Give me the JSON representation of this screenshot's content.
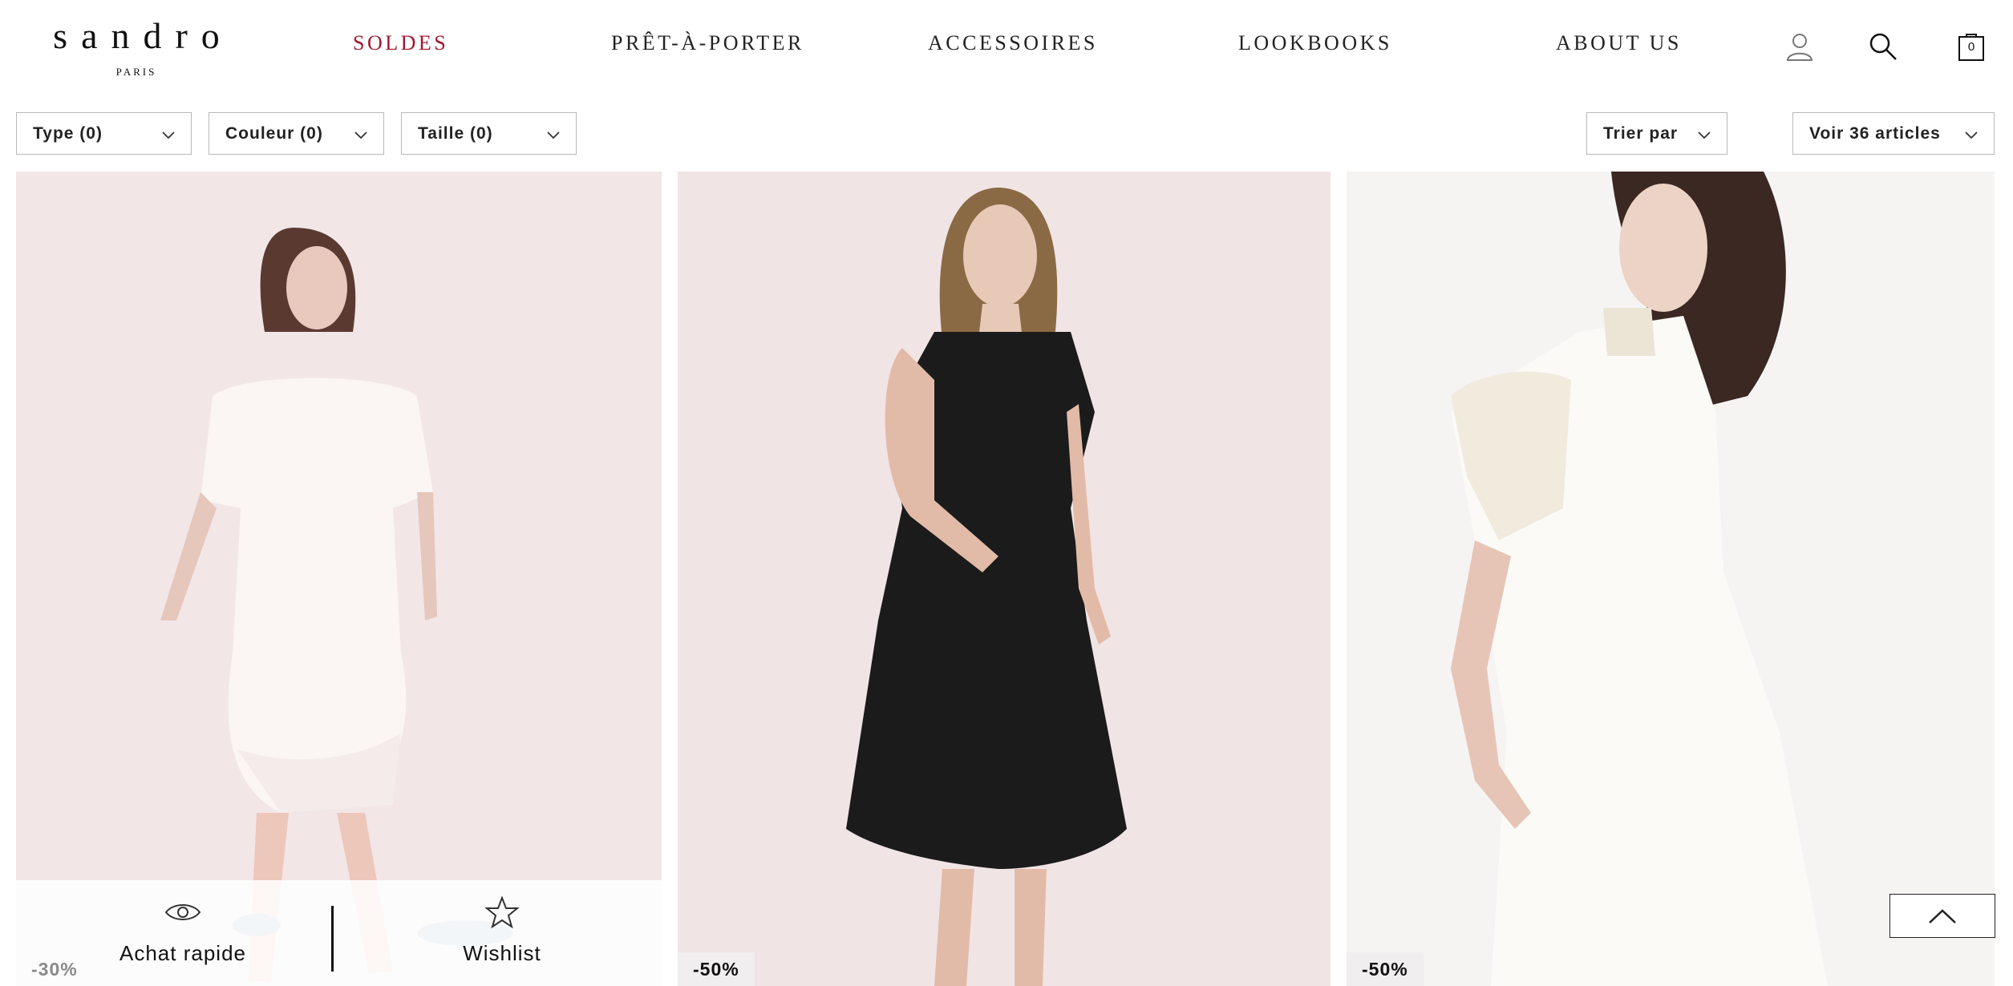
{
  "brand": {
    "name": "sandro",
    "sub": "PARIS"
  },
  "nav": [
    {
      "label": "SOLDES"
    },
    {
      "label": "PRÊT-À-PORTER"
    },
    {
      "label": "ACCESSOIRES"
    },
    {
      "label": "LOOKBOOKS"
    },
    {
      "label": "ABOUT US"
    }
  ],
  "header_icons": [
    "user-icon",
    "search-icon",
    "bag-icon"
  ],
  "cart": {
    "count": "0"
  },
  "filters": [
    {
      "label": "Type (0)"
    },
    {
      "label": "Couleur (0)"
    },
    {
      "label": "Taille (0)"
    }
  ],
  "sort": {
    "label": "Trier par"
  },
  "view": {
    "label": "Voir 36 articles"
  },
  "products": [
    {
      "discount": "-30%",
      "quick_buy": "Achat rapide",
      "wishlist": "Wishlist"
    },
    {
      "discount": "-50%"
    },
    {
      "discount": "-50%"
    }
  ],
  "colors": {
    "sale_nav": "#a1182e",
    "border": "#b9b9b9",
    "photo_pink": "#f2e6e7",
    "photo_white": "#f6f4f3"
  }
}
